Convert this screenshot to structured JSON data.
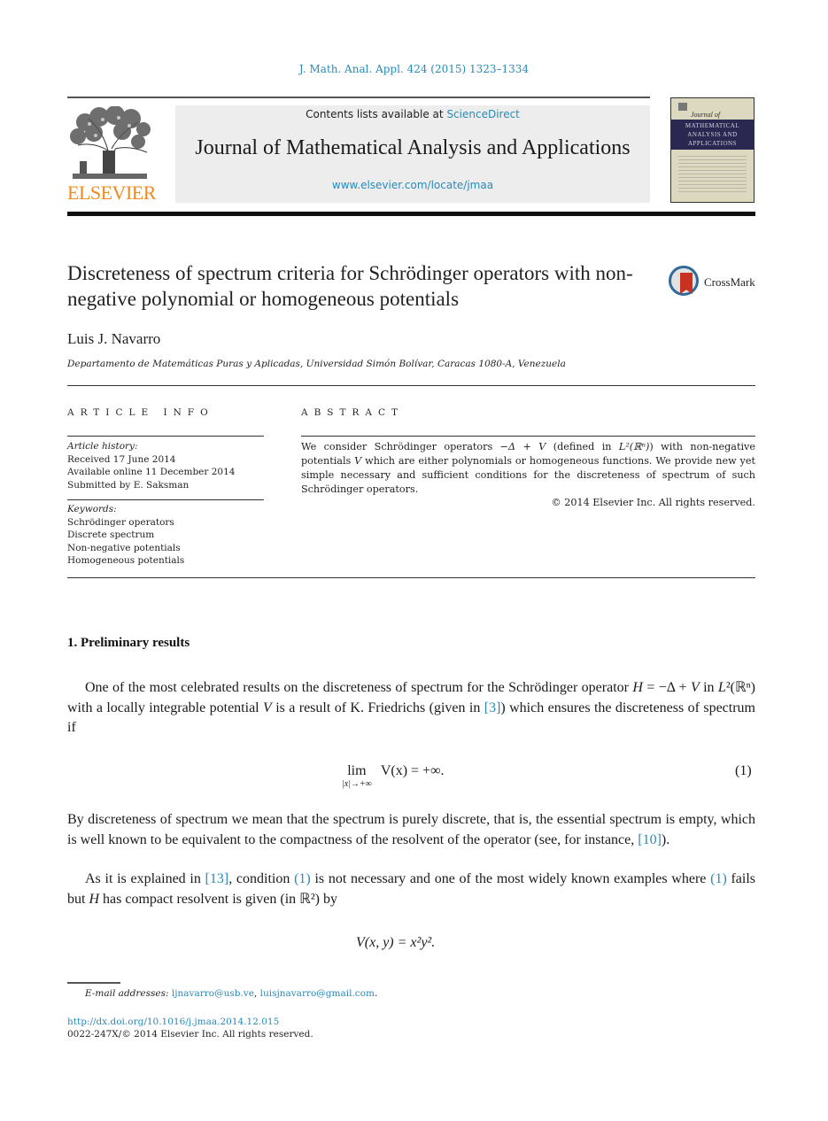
{
  "header": {
    "citation": "J. Math. Anal. Appl. 424 (2015) 1323–1334",
    "publisher_logo_text": "ELSEVIER",
    "contents_prefix": "Contents lists available at ",
    "contents_link": "ScienceDirect",
    "journal_name": "Journal of Mathematical Analysis and Applications",
    "journal_url": "www.elsevier.com/locate/jmaa",
    "cover": {
      "script_title": "Journal of",
      "band_lines": [
        "MATHEMATICAL",
        "ANALYSIS AND",
        "APPLICATIONS"
      ],
      "band_color": "#2a2850",
      "background_color": "#ddd8c0"
    }
  },
  "article": {
    "title": "Discreteness of spectrum criteria for Schrödinger operators with non-negative polynomial or homogeneous potentials",
    "crossmark_label": "CrossMark",
    "author": "Luis J. Navarro",
    "affiliation": "Departamento de Matemáticas Puras y Aplicadas, Universidad Simón Bolívar, Caracas 1080-A, Venezuela"
  },
  "article_info": {
    "heading": "ARTICLE INFO",
    "history_label": "Article history:",
    "history": [
      "Received 17 June 2014",
      "Available online 11 December 2014",
      "Submitted by E. Saksman"
    ],
    "keywords_label": "Keywords:",
    "keywords": [
      "Schrödinger operators",
      "Discrete spectrum",
      "Non-negative potentials",
      "Homogeneous potentials"
    ]
  },
  "abstract": {
    "heading": "ABSTRACT",
    "text_1": "We consider Schrödinger operators ",
    "math_1": "−Δ + V",
    "text_2": " (defined in ",
    "math_2": "L²(ℝⁿ)",
    "text_3": ") with non-negative potentials ",
    "math_3": "V",
    "text_4": " which are either polynomials or homogeneous functions. We provide new yet simple necessary and sufficient conditions for the discreteness of spectrum of such Schrödinger operators.",
    "copyright": "© 2014 Elsevier Inc. All rights reserved."
  },
  "section1": {
    "title": "1.  Preliminary results",
    "p1": {
      "t1": "One of the most celebrated results on the discreteness of spectrum for the Schrödinger operator ",
      "m1": "H",
      "t2": " = −Δ + ",
      "m2": "V",
      "t3": " in ",
      "m3": "L",
      "t4": "²(ℝⁿ) with a locally integrable potential ",
      "m4": "V",
      "t5": " is a result of K. Friedrichs (given in ",
      "ref": "[3]",
      "t6": ") which ensures the discreteness of spectrum if"
    },
    "eq1": {
      "lim": "lim",
      "sub": "|x|→+∞",
      "body": "V(x) = +∞.",
      "number": "(1)"
    },
    "p2": {
      "t1": "By discreteness of spectrum we mean that the spectrum is purely discrete, that is, the essential spectrum is empty, which is well known to be equivalent to the compactness of the resolvent of the operator (see, for instance, ",
      "ref": "[10]",
      "t2": ")."
    },
    "p3": {
      "t1": "As it is explained in ",
      "ref1": "[13]",
      "t2": ", condition ",
      "ref2": "(1)",
      "t3": " is not necessary and one of the most widely known examples where ",
      "ref3": "(1)",
      "t4": " fails but ",
      "m1": "H",
      "t5": " has compact resolvent is given (in ℝ²) by"
    },
    "eq2": "V(x, y) = x²y².",
    "math_italic": "x"
  },
  "footnotes": {
    "email_label": "E-mail addresses:",
    "email_1": "ljnavarro@usb.ve",
    "sep": ", ",
    "email_2": "luisjnavarro@gmail.com",
    "end": ".",
    "doi": "http://dx.doi.org/10.1016/j.jmaa.2014.12.015",
    "issn_line": "0022-247X/© 2014 Elsevier Inc. All rights reserved."
  },
  "colors": {
    "link": "#2a8ab8",
    "elsevier_orange": "#f08a1c",
    "banner_bg": "#ededed"
  }
}
